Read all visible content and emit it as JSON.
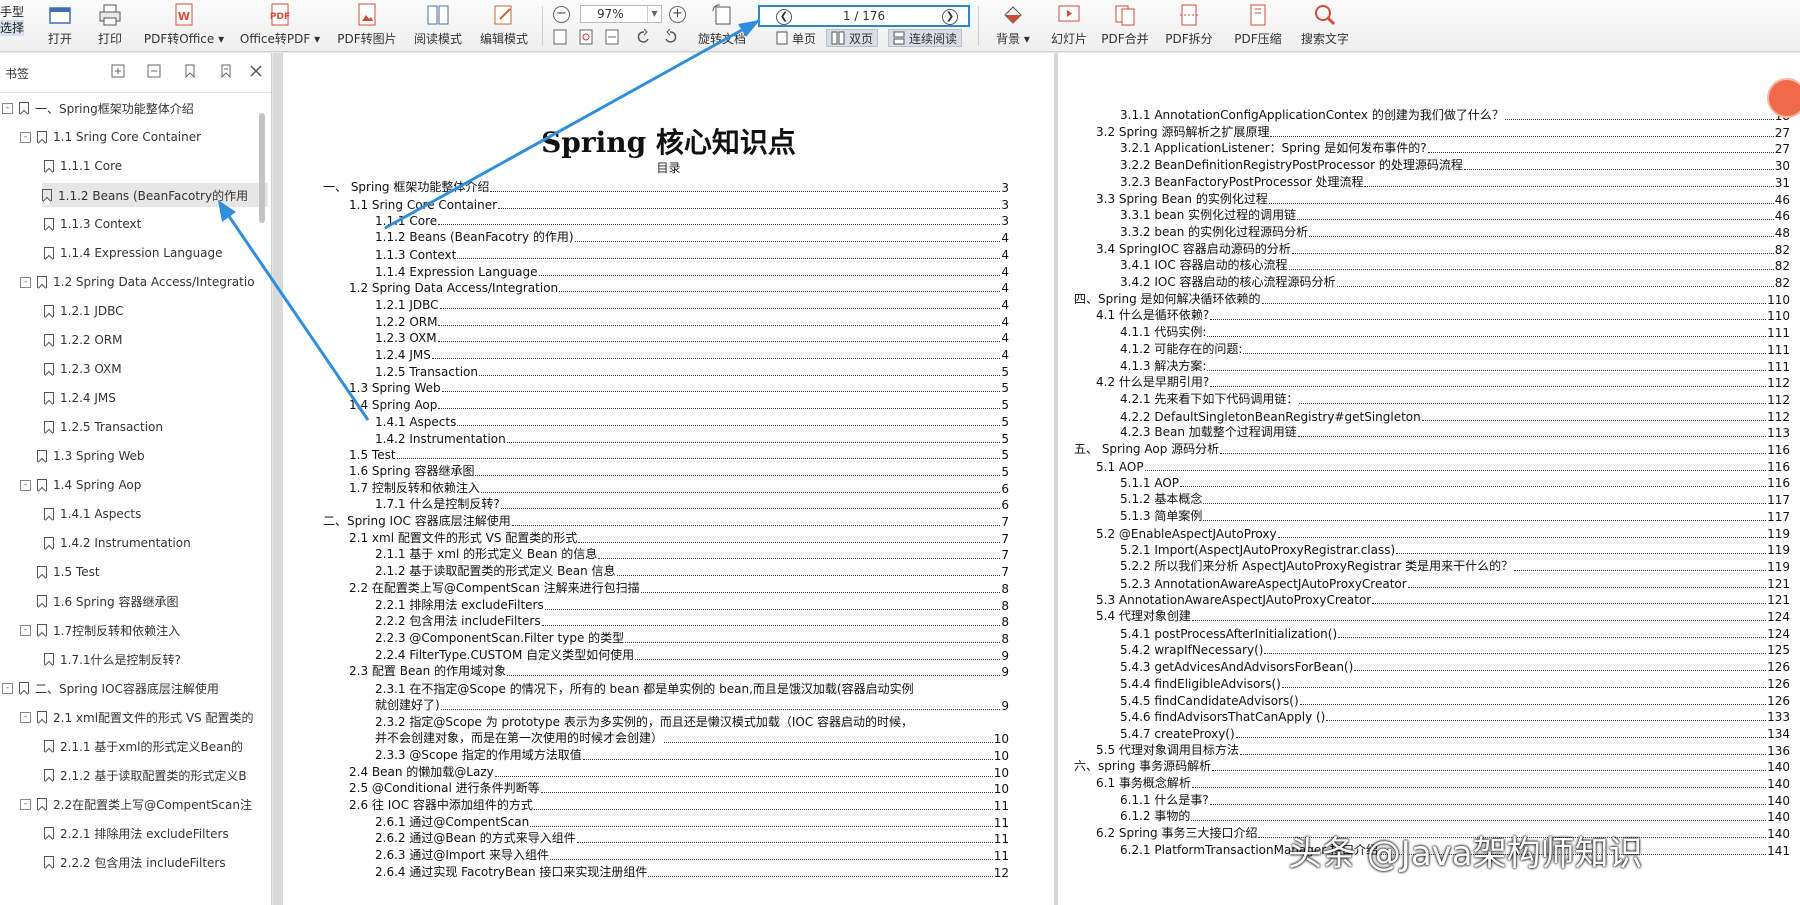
{
  "toolbar": {
    "partial": [
      "手型",
      "选择"
    ],
    "buttons": [
      {
        "label": "打开",
        "icon": "open-icon"
      },
      {
        "label": "打印",
        "icon": "print-icon"
      },
      {
        "label": "PDF转Office ▾",
        "icon": "pdf-to-office-icon"
      },
      {
        "label": "Office转PDF ▾",
        "icon": "office-to-pdf-icon"
      },
      {
        "label": "PDF转图片",
        "icon": "pdf-to-image-icon"
      },
      {
        "label": "阅读模式",
        "icon": "read-mode-icon"
      },
      {
        "label": "编辑模式",
        "icon": "edit-mode-icon"
      },
      {
        "label": "旋转文档",
        "icon": "rotate-doc-icon"
      },
      {
        "label": "背景 ▾",
        "icon": "background-icon"
      },
      {
        "label": "幻灯片",
        "icon": "slideshow-icon"
      },
      {
        "label": "PDF合并",
        "icon": "pdf-merge-icon"
      },
      {
        "label": "PDF拆分",
        "icon": "pdf-split-icon"
      },
      {
        "label": "PDF压缩",
        "icon": "pdf-compress-icon"
      },
      {
        "label": "搜索文字",
        "icon": "search-icon"
      }
    ],
    "zoom": "97%",
    "page_indicator": "1 / 176",
    "view_single": "单页",
    "view_double": "双页",
    "view_continuous": "连续阅读"
  },
  "sidebar": {
    "title": "书签",
    "items": [
      {
        "label": "一、Spring框架功能整体介绍",
        "level": 0,
        "toggle": "-"
      },
      {
        "label": "1.1 Sring Core Container",
        "level": 1,
        "toggle": "-"
      },
      {
        "label": "1.1.1 Core",
        "level": 2,
        "toggle": ""
      },
      {
        "label": "1.1.2 Beans (BeanFacotry的作用",
        "level": 2,
        "toggle": "",
        "selected": true
      },
      {
        "label": "1.1.3 Context",
        "level": 2,
        "toggle": ""
      },
      {
        "label": "1.1.4 Expression Language",
        "level": 2,
        "toggle": ""
      },
      {
        "label": "1.2 Spring Data Access/Integratio",
        "level": 1,
        "toggle": "-"
      },
      {
        "label": "1.2.1 JDBC",
        "level": 2,
        "toggle": ""
      },
      {
        "label": "1.2.2 ORM",
        "level": 2,
        "toggle": ""
      },
      {
        "label": "1.2.3 OXM",
        "level": 2,
        "toggle": ""
      },
      {
        "label": "1.2.4 JMS",
        "level": 2,
        "toggle": ""
      },
      {
        "label": "1.2.5 Transaction",
        "level": 2,
        "toggle": ""
      },
      {
        "label": "1.3 Spring Web",
        "level": 1,
        "toggle": ""
      },
      {
        "label": "1.4 Spring Aop",
        "level": 1,
        "toggle": "-"
      },
      {
        "label": "1.4.1 Aspects",
        "level": 2,
        "toggle": ""
      },
      {
        "label": "1.4.2 Instrumentation",
        "level": 2,
        "toggle": ""
      },
      {
        "label": "1.5 Test",
        "level": 1,
        "toggle": ""
      },
      {
        "label": "1.6 Spring 容器继承图",
        "level": 1,
        "toggle": ""
      },
      {
        "label": "1.7控制反转和依赖注入",
        "level": 1,
        "toggle": "-"
      },
      {
        "label": "1.7.1什么是控制反转?",
        "level": 2,
        "toggle": ""
      },
      {
        "label": "二、Spring IOC容器底层注解使用",
        "level": 0,
        "toggle": "-"
      },
      {
        "label": "2.1 xml配置文件的形式 VS 配置类的",
        "level": 1,
        "toggle": "-"
      },
      {
        "label": "2.1.1 基于xml的形式定义Bean的",
        "level": 2,
        "toggle": ""
      },
      {
        "label": "2.1.2 基于读取配置类的形式定义B",
        "level": 2,
        "toggle": ""
      },
      {
        "label": "2.2在配置类上写@CompentScan注",
        "level": 1,
        "toggle": "-"
      },
      {
        "label": "2.2.1 排除用法 excludeFilters",
        "level": 2,
        "toggle": ""
      },
      {
        "label": "2.2.2 包含用法 includeFilters",
        "level": 2,
        "toggle": ""
      }
    ]
  },
  "page1": {
    "title": "Spring 核心知识点",
    "subtitle": "目录",
    "toc": [
      {
        "text": "一、 Spring 框架功能整体介绍",
        "page": "3",
        "indent": 0
      },
      {
        "text": "1.1 Sring Core Container",
        "page": "3",
        "indent": 1
      },
      {
        "text": "1.1.1 Core",
        "page": "3",
        "indent": 2
      },
      {
        "text": "1.1.2 Beans (BeanFacotry 的作用)",
        "page": "4",
        "indent": 2
      },
      {
        "text": "1.1.3 Context",
        "page": "4",
        "indent": 2
      },
      {
        "text": "1.1.4 Expression Language",
        "page": "4",
        "indent": 2
      },
      {
        "text": "1.2 Spring Data Access/Integration",
        "page": "4",
        "indent": 1
      },
      {
        "text": "1.2.1 JDBC",
        "page": "4",
        "indent": 2
      },
      {
        "text": "1.2.2 ORM",
        "page": "4",
        "indent": 2
      },
      {
        "text": "1.2.3 OXM",
        "page": "4",
        "indent": 2
      },
      {
        "text": "1.2.4 JMS",
        "page": "4",
        "indent": 2
      },
      {
        "text": "1.2.5 Transaction",
        "page": "5",
        "indent": 2
      },
      {
        "text": "1.3 Spring Web",
        "page": "5",
        "indent": 1
      },
      {
        "text": "1.4 Spring Aop",
        "page": "5",
        "indent": 1
      },
      {
        "text": "1.4.1 Aspects",
        "page": "5",
        "indent": 2
      },
      {
        "text": "1.4.2 Instrumentation",
        "page": "5",
        "indent": 2
      },
      {
        "text": "1.5 Test",
        "page": "5",
        "indent": 1
      },
      {
        "text": "1.6 Spring 容器继承图",
        "page": "5",
        "indent": 1
      },
      {
        "text": "1.7 控制反转和依赖注入",
        "page": "6",
        "indent": 1
      },
      {
        "text": "1.7.1 什么是控制反转?",
        "page": "6",
        "indent": 2
      },
      {
        "text": "二、Spring IOC 容器底层注解使用",
        "page": "7",
        "indent": 0
      },
      {
        "text": "2.1 xml 配置文件的形式 VS 配置类的形式",
        "page": "7",
        "indent": 1
      },
      {
        "text": "2.1.1 基于 xml 的形式定义 Bean 的信息",
        "page": "7",
        "indent": 2
      },
      {
        "text": "2.1.2 基于读取配置类的形式定义 Bean 信息",
        "page": "7",
        "indent": 2
      },
      {
        "text": "2.2 在配置类上写@CompentScan 注解来进行包扫描",
        "page": "8",
        "indent": 1
      },
      {
        "text": "2.2.1 排除用法 excludeFilters",
        "page": "8",
        "indent": 2
      },
      {
        "text": "2.2.2 包含用法 includeFilters",
        "page": "8",
        "indent": 2
      },
      {
        "text": "2.2.3 @ComponentScan.Filter type 的类型",
        "page": "8",
        "indent": 2
      },
      {
        "text": "2.2.4 FilterType.CUSTOM 自定义类型如何使用",
        "page": "9",
        "indent": 2
      },
      {
        "text": "2.3 配置 Bean 的作用域对象",
        "page": "9",
        "indent": 1
      }
    ],
    "wrap1_line1": "2.3.1 在不指定@Scope 的情况下，所有的 bean 都是单实例的 bean,而且是饿汉加载(容器启动实例",
    "wrap1_line2": "就创建好了)",
    "wrap1_page": "9",
    "wrap2_line1": "2.3.2 指定@Scope 为 prototype 表示为多实例的，而且还是懒汉模式加载（IOC 容器启动的时候，",
    "wrap2_line2": "并不会创建对象，而是在第一次使用的时候才会创建）",
    "wrap2_page": "10",
    "toc_tail": [
      {
        "text": "2.3.3 @Scope 指定的作用域方法取值",
        "page": "10",
        "indent": 2
      },
      {
        "text": "2.4 Bean 的懒加载@Lazy",
        "page": "10",
        "indent": 1
      },
      {
        "text": "2.5 @Conditional 进行条件判断等",
        "page": "10",
        "indent": 1
      },
      {
        "text": "2.6 往 IOC 容器中添加组件的方式",
        "page": "11",
        "indent": 1
      },
      {
        "text": "2.6.1 通过@CompentScan",
        "page": "11",
        "indent": 2
      },
      {
        "text": "2.6.2 通过@Bean 的方式来导入组件",
        "page": "11",
        "indent": 2
      },
      {
        "text": "2.6.3 通过@Import 来导入组件",
        "page": "11",
        "indent": 2
      },
      {
        "text": "2.6.4 通过实现 FacotryBean 接口来实现注册组件",
        "page": "12",
        "indent": 2
      }
    ]
  },
  "page2": {
    "toc": [
      {
        "text": "3.1.1 AnnotationConfigApplicationContex 的创建为我们做了什么？",
        "page": "18",
        "indent": 2
      },
      {
        "text": "3.2 Spring 源码解析之扩展原理",
        "page": "27",
        "indent": 1
      },
      {
        "text": "3.2.1 ApplicationListener：Spring 是如何发布事件的?",
        "page": "27",
        "indent": 2
      },
      {
        "text": "3.2.2 BeanDefinitionRegistryPostProcessor 的处理源码流程",
        "page": "30",
        "indent": 2
      },
      {
        "text": "3.2.3 BeanFactoryPostProcessor 处理流程",
        "page": "31",
        "indent": 2
      },
      {
        "text": "3.3 Spring Bean 的实例化过程",
        "page": "46",
        "indent": 1
      },
      {
        "text": "3.3.1 bean 实例化过程的调用链",
        "page": "46",
        "indent": 2
      },
      {
        "text": "3.3.2 bean 的实例化过程源码分析",
        "page": "48",
        "indent": 2
      },
      {
        "text": "3.4 SpringIOC 容器启动源码的分析",
        "page": "82",
        "indent": 1
      },
      {
        "text": "3.4.1 IOC 容器启动的核心流程",
        "page": "82",
        "indent": 2
      },
      {
        "text": "3.4.2 IOC 容器启动的核心流程源码分析",
        "page": "82",
        "indent": 2
      },
      {
        "text": "四、Spring 是如何解决循环依赖的",
        "page": "110",
        "indent": 0
      },
      {
        "text": "4.1 什么是循环依赖?",
        "page": "110",
        "indent": 1
      },
      {
        "text": "4.1.1 代码实例:",
        "page": "111",
        "indent": 2
      },
      {
        "text": "4.1.2 可能存在的问题:",
        "page": "111",
        "indent": 2
      },
      {
        "text": "4.1.3 解决方案:",
        "page": "111",
        "indent": 2
      },
      {
        "text": "4.2 什么是早期引用?",
        "page": "112",
        "indent": 1
      },
      {
        "text": "4.2.1 先来看下如下代码调用链：",
        "page": "112",
        "indent": 2
      },
      {
        "text": "4.2.2 DefaultSingletonBeanRegistry#getSingleton",
        "page": "112",
        "indent": 2
      },
      {
        "text": "4.2.3 Bean 加载整个过程调用链",
        "page": "113",
        "indent": 2
      },
      {
        "text": "五、 Spring Aop 源码分析",
        "page": "116",
        "indent": 0
      },
      {
        "text": "5.1 AOP",
        "page": "116",
        "indent": 1
      },
      {
        "text": "5.1.1 AOP",
        "page": "116",
        "indent": 2
      },
      {
        "text": "5.1.2 基本概念",
        "page": "117",
        "indent": 2
      },
      {
        "text": "5.1.3 简单案例",
        "page": "117",
        "indent": 2
      },
      {
        "text": "5.2 @EnableAspectJAutoProxy",
        "page": "119",
        "indent": 1
      },
      {
        "text": "5.2.1 Import(AspectJAutoProxyRegistrar.class)",
        "page": "119",
        "indent": 2
      },
      {
        "text": "5.2.2 所以我们来分析 AspectJAutoProxyRegistrar 类是用来干什么的？",
        "page": "119",
        "indent": 2
      },
      {
        "text": "5.2.3 AnnotationAwareAspectJAutoProxyCreator",
        "page": "121",
        "indent": 2
      },
      {
        "text": "5.3 AnnotationAwareAspectJAutoProxyCreator",
        "page": "121",
        "indent": 1
      },
      {
        "text": "5.4 代理对象创建",
        "page": "124",
        "indent": 1
      },
      {
        "text": "5.4.1 postProcessAfterInitialization()",
        "page": "124",
        "indent": 2
      },
      {
        "text": "5.4.2 wrapIfNecessary()",
        "page": "125",
        "indent": 2
      },
      {
        "text": "5.4.3 getAdvicesAndAdvisorsForBean()",
        "page": "126",
        "indent": 2
      },
      {
        "text": "5.4.4 findEligibleAdvisors()",
        "page": "126",
        "indent": 2
      },
      {
        "text": "5.4.5 findCandidateAdvisors()",
        "page": "126",
        "indent": 2
      },
      {
        "text": "5.4.6 findAdvisorsThatCanApply ()",
        "page": "133",
        "indent": 2
      },
      {
        "text": "5.4.7 createProxy()",
        "page": "134",
        "indent": 2
      },
      {
        "text": "5.5 代理对象调用目标方法",
        "page": "136",
        "indent": 1
      },
      {
        "text": "六、spring 事务源码解析",
        "page": "140",
        "indent": 0
      },
      {
        "text": "6.1 事务概念解析",
        "page": "140",
        "indent": 1
      },
      {
        "text": "6.1.1 什么是事?",
        "page": "140",
        "indent": 2
      },
      {
        "text": "6.1.2 事物的",
        "page": "140",
        "indent": 2
      },
      {
        "text": "6.2 Spring 事务三大接口介绍",
        "page": "140",
        "indent": 1
      },
      {
        "text": "6.2.1 PlatformTransactionManager 接口介绍",
        "page": "141",
        "indent": 2
      }
    ]
  },
  "watermark": "头条 @Java架构师知识",
  "colors": {
    "highlight": "#2a86d0",
    "arrow": "#2f8fdc",
    "float": "#f06a4a"
  }
}
